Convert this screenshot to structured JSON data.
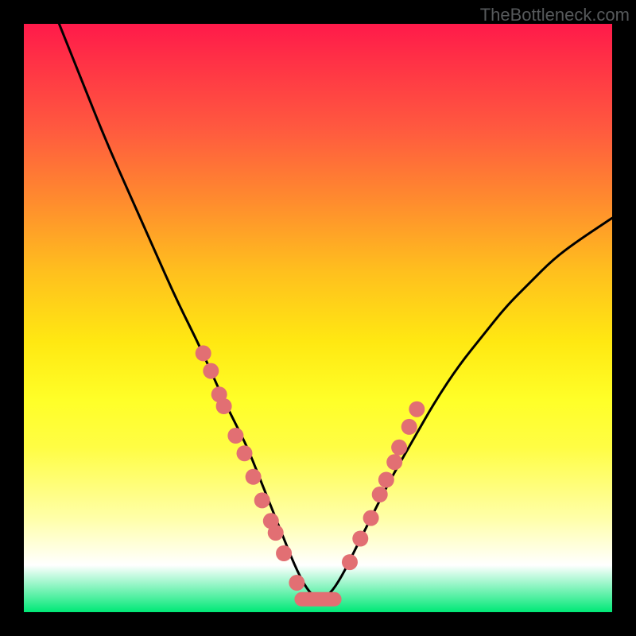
{
  "watermark": "TheBottleneck.com",
  "chart_data": {
    "type": "line",
    "title": "",
    "xlabel": "",
    "ylabel": "",
    "xlim": [
      0,
      100
    ],
    "ylim": [
      0,
      100
    ],
    "series": [
      {
        "name": "curve",
        "color": "#000000",
        "x": [
          6,
          10,
          14,
          18,
          22,
          26,
          30,
          34,
          36,
          38,
          40,
          42,
          44,
          46,
          48,
          50,
          52,
          54,
          56,
          58,
          62,
          66,
          70,
          74,
          78,
          82,
          86,
          90,
          94,
          100
        ],
        "values": [
          100,
          90,
          80,
          71,
          62,
          53,
          45,
          36,
          32,
          28,
          23,
          18,
          13,
          8,
          4,
          2,
          3,
          6,
          10,
          14,
          22,
          29,
          36,
          42,
          47,
          52,
          56,
          60,
          63,
          67
        ]
      }
    ],
    "left_dots": {
      "color": "#e26f73",
      "points": [
        {
          "x": 30.5,
          "y": 44
        },
        {
          "x": 31.8,
          "y": 41
        },
        {
          "x": 33.2,
          "y": 37
        },
        {
          "x": 34.0,
          "y": 35
        },
        {
          "x": 36.0,
          "y": 30
        },
        {
          "x": 37.5,
          "y": 27
        },
        {
          "x": 39.0,
          "y": 23
        },
        {
          "x": 40.5,
          "y": 19
        },
        {
          "x": 42.0,
          "y": 15.5
        },
        {
          "x": 42.8,
          "y": 13.5
        },
        {
          "x": 44.2,
          "y": 10
        },
        {
          "x": 46.4,
          "y": 5
        }
      ]
    },
    "right_dots": {
      "color": "#e26f73",
      "points": [
        {
          "x": 55.4,
          "y": 8.5
        },
        {
          "x": 57.2,
          "y": 12.5
        },
        {
          "x": 59.0,
          "y": 16
        },
        {
          "x": 60.5,
          "y": 20
        },
        {
          "x": 61.6,
          "y": 22.5
        },
        {
          "x": 63.0,
          "y": 25.5
        },
        {
          "x": 63.8,
          "y": 28
        },
        {
          "x": 65.5,
          "y": 31.5
        },
        {
          "x": 66.8,
          "y": 34.5
        }
      ]
    },
    "valley_bar": {
      "color": "#e26f73",
      "x_start": 46,
      "x_end": 54,
      "y": 2.2
    }
  }
}
